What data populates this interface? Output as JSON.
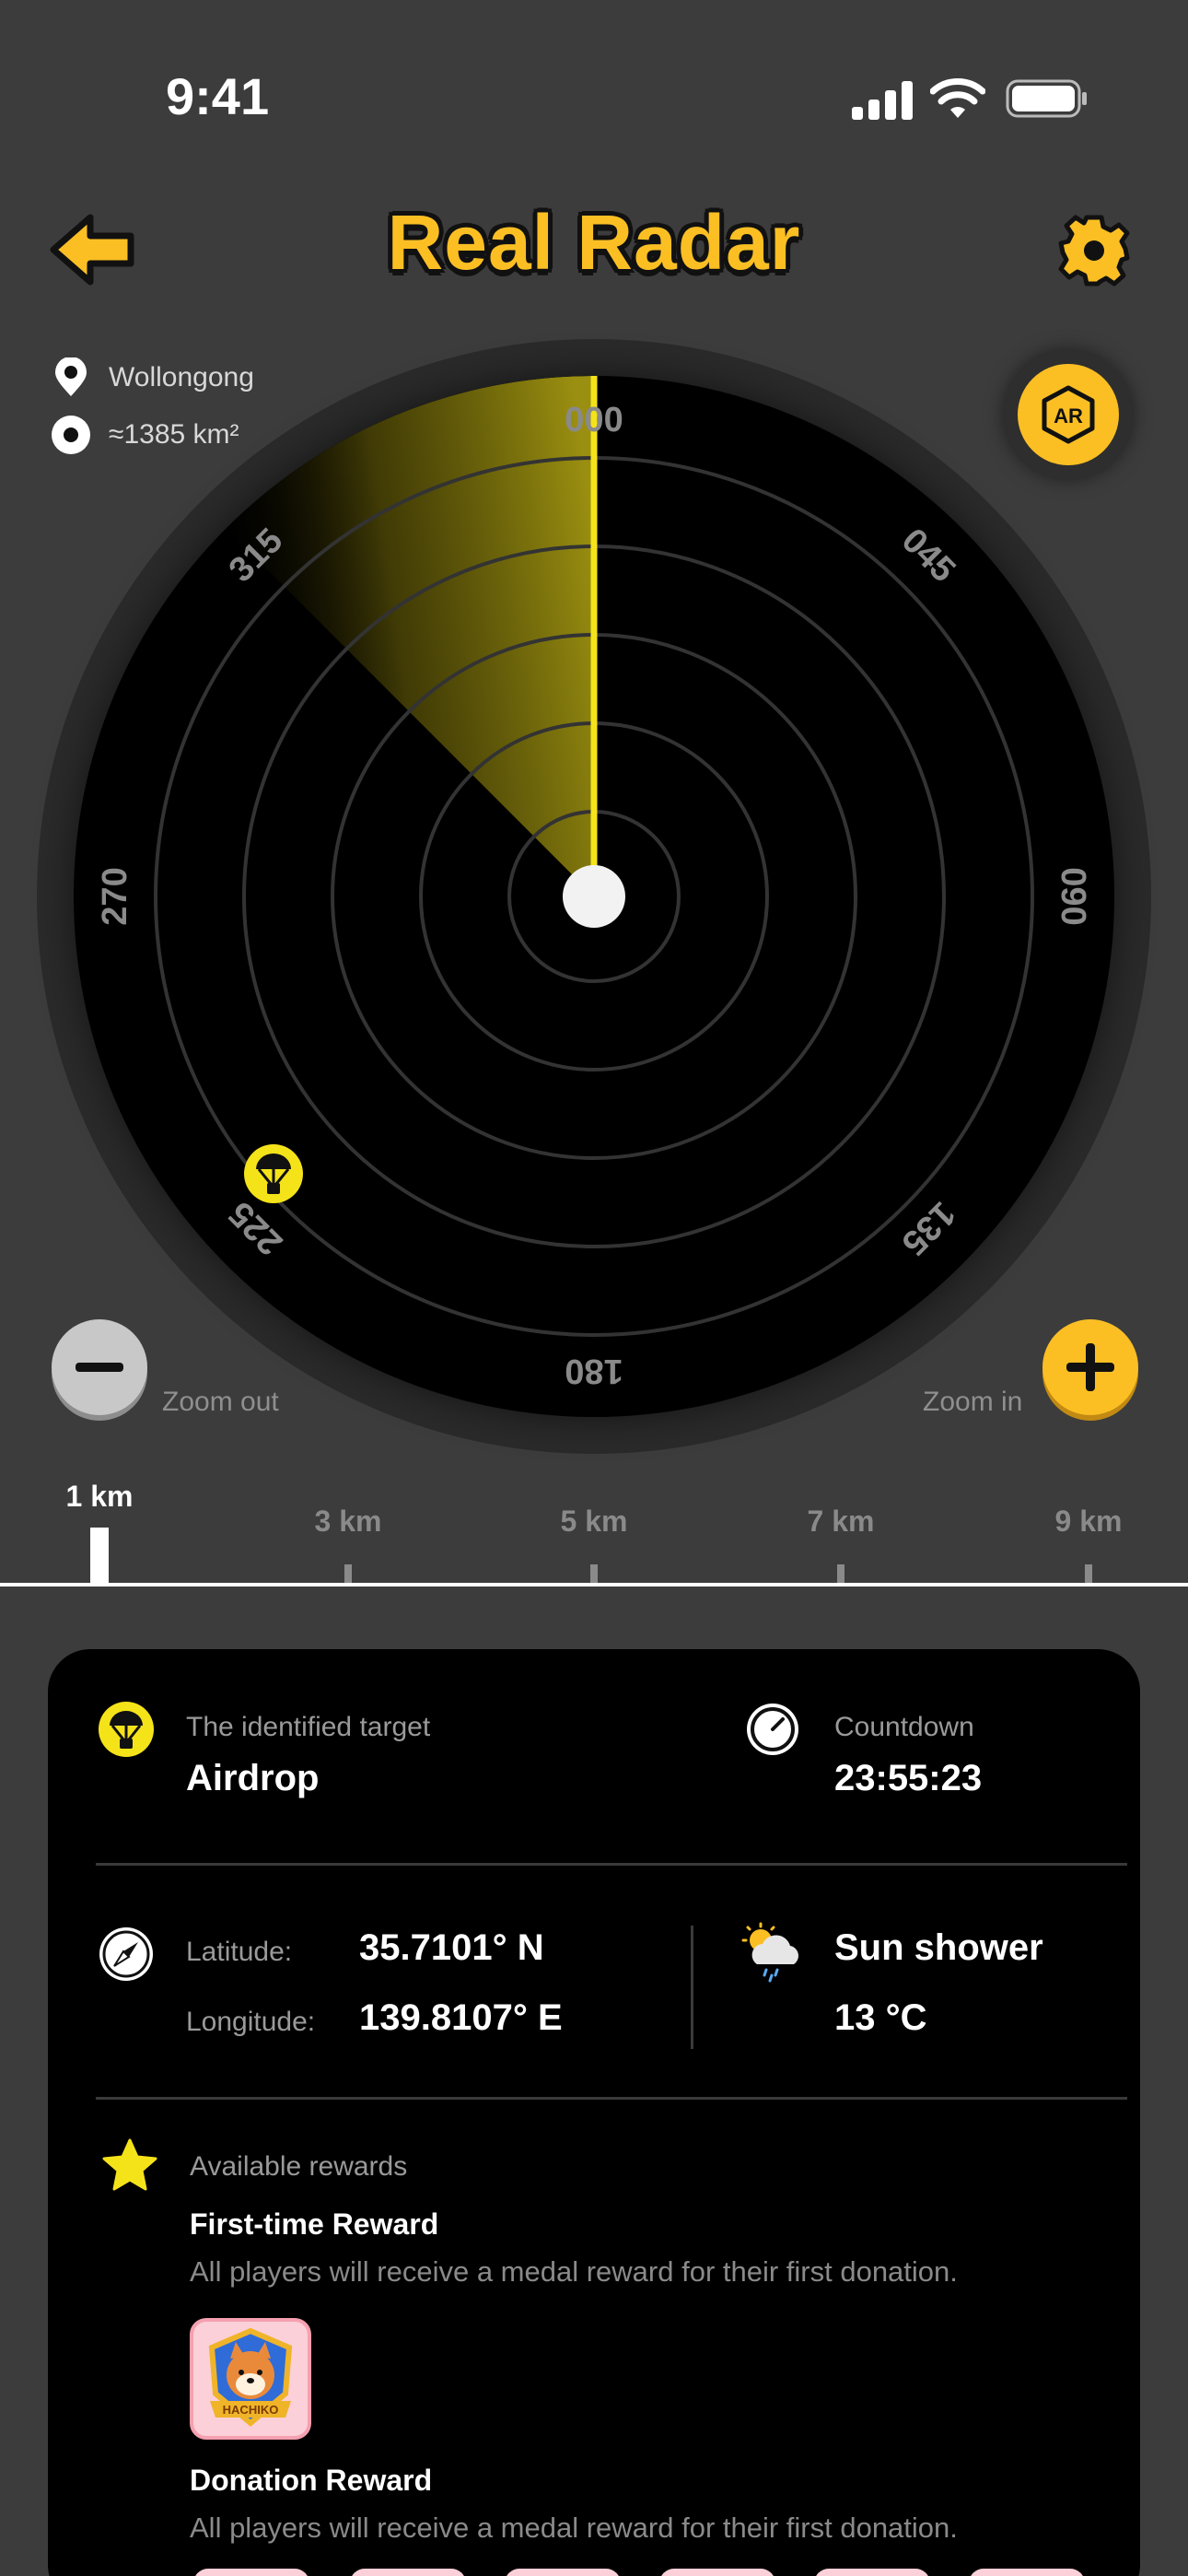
{
  "status_bar": {
    "time": "9:41"
  },
  "header": {
    "title": "Real Radar"
  },
  "location": {
    "city": "Wollongong",
    "area": "≈1385 km²"
  },
  "radar": {
    "bearings": [
      "000",
      "045",
      "090",
      "135",
      "180",
      "225",
      "270",
      "315"
    ],
    "target_icon": "airdrop-icon"
  },
  "zoom": {
    "out_label": "Zoom out",
    "in_label": "Zoom in"
  },
  "scale": {
    "labels": [
      "1 km",
      "3 km",
      "5 km",
      "7 km",
      "9 km"
    ],
    "selected": "1 km"
  },
  "card": {
    "target": {
      "label": "The identified target",
      "value": "Airdrop"
    },
    "countdown": {
      "label": "Countdown",
      "value": "23:55:23"
    },
    "coords": {
      "lat_label": "Latitude:",
      "lat_value": "35.7101° N",
      "lon_label": "Longitude:",
      "lon_value": "139.8107° E"
    },
    "weather": {
      "condition": "Sun shower",
      "temperature": "13 °C"
    },
    "rewards": {
      "label": "Available rewards",
      "items": [
        {
          "title": "First-time Reward",
          "desc": "All players will receive a medal reward for their first donation.",
          "medal_text": "HACHIKO"
        },
        {
          "title": "Donation Reward",
          "desc": "All players will receive a medal reward for their first donation."
        }
      ]
    }
  },
  "colors": {
    "accent": "#fbbf24",
    "background": "#3c3c3c",
    "card": "#000000"
  }
}
